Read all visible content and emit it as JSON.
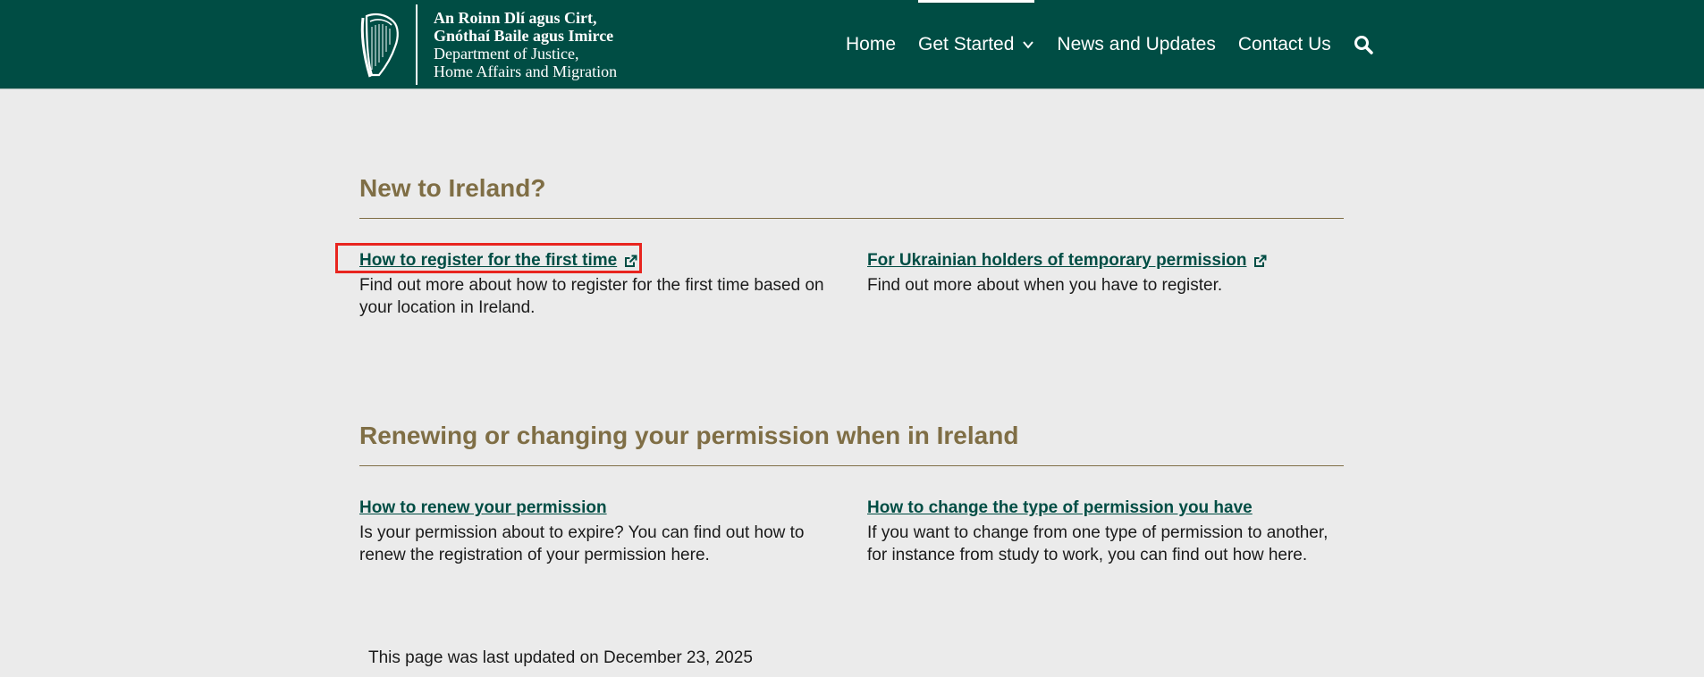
{
  "header": {
    "brand_lines_ga": [
      "An Roinn Dlí agus Cirt,",
      "Gnóthaí Baile agus Imirce"
    ],
    "brand_lines_en": [
      "Department of Justice,",
      "Home Affairs and Migration"
    ],
    "logo_icon": "harp-icon"
  },
  "nav": {
    "home": "Home",
    "get_started": "Get Started",
    "news": "News and Updates",
    "contact": "Contact Us",
    "search_icon": "search-icon",
    "dropdown_icon": "chevron-down-icon"
  },
  "sections": [
    {
      "title": "New to Ireland?",
      "items": [
        {
          "link": "How to register for the first time",
          "external": true,
          "description": "Find out more about how to register for the first time based on your location in Ireland."
        },
        {
          "link": "For Ukrainian holders of temporary permission",
          "external": true,
          "description": "Find out more about when you have to register."
        }
      ]
    },
    {
      "title": "Renewing or changing your permission when in Ireland",
      "items": [
        {
          "link": "How to renew your permission",
          "external": false,
          "description": "Is your permission about to expire? You can find out how to renew the registration of your permission here."
        },
        {
          "link": "How to change the type of permission you have",
          "external": false,
          "description": "If you want to change from one type of permission to another, for instance from study to work, you can find out how here."
        }
      ]
    }
  ],
  "footer": {
    "last_updated": "This page was last updated on December 23, 2025"
  },
  "colors": {
    "header_bg": "#004d44",
    "page_bg": "#ebebeb",
    "heading": "#7f6e45",
    "link": "#004d44",
    "highlight": "#e8251f"
  }
}
